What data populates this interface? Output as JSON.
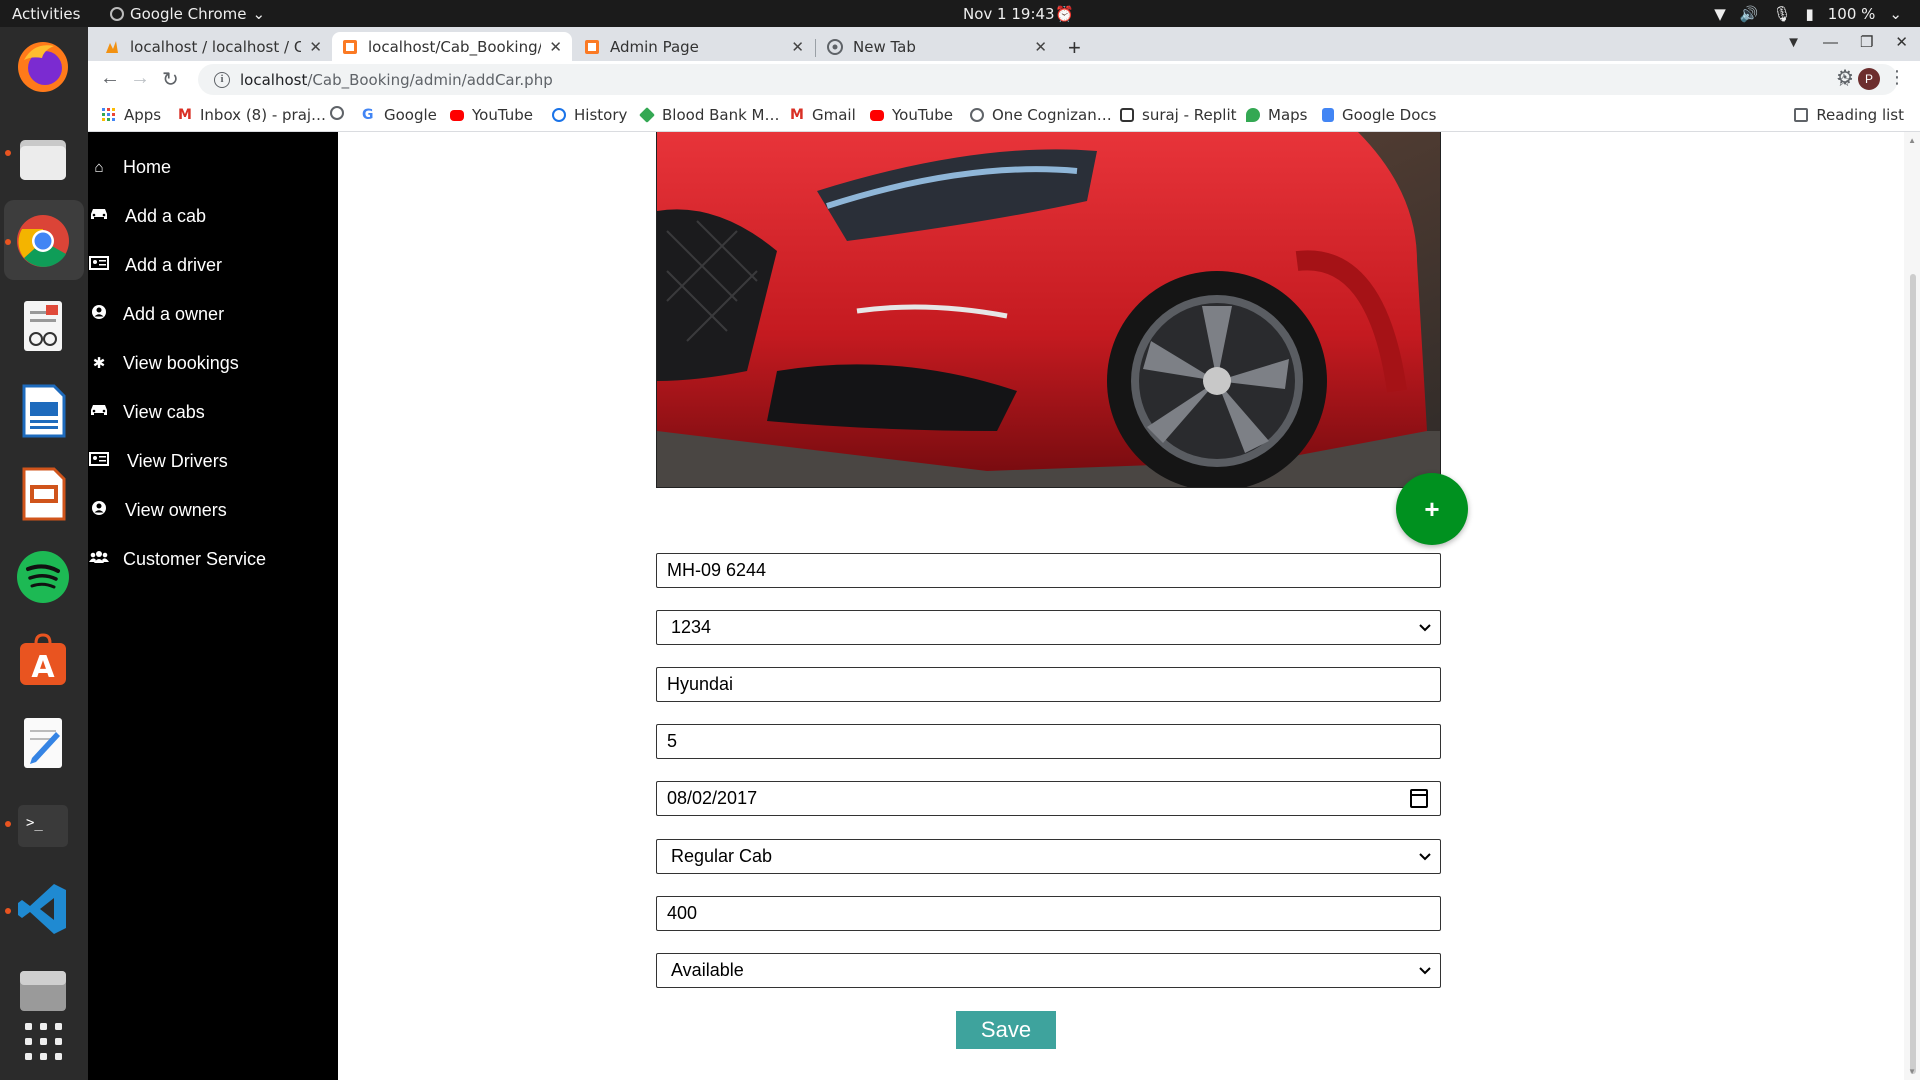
{
  "system_bar": {
    "activities": "Activities",
    "app_name": "Google Chrome",
    "clock": "Nov 1  19:43",
    "battery": "100 %"
  },
  "browser": {
    "tabs": [
      {
        "title": "localhost / localhost / Ca…",
        "active": false
      },
      {
        "title": "localhost/Cab_Booking/a…",
        "active": true
      },
      {
        "title": "Admin Page",
        "active": false
      },
      {
        "title": "New Tab",
        "active": false
      }
    ],
    "url_host": "localhost",
    "url_path": "/Cab_Booking/admin/addCar.php",
    "profile_initial": "P",
    "bookmarks": [
      {
        "label": "Apps",
        "icon": "apps-grid-icon",
        "color": "#4285f4"
      },
      {
        "label": "Inbox (8) - praj…",
        "icon": "gmail-icon",
        "color": "#d93025"
      },
      {
        "label": "",
        "icon": "globe-icon",
        "color": "#5f6368"
      },
      {
        "label": "Google",
        "icon": "google-icon",
        "color": "#4285f4"
      },
      {
        "label": "YouTube",
        "icon": "youtube-icon",
        "color": "#ff0000"
      },
      {
        "label": "History",
        "icon": "history-icon",
        "color": "#1a73e8"
      },
      {
        "label": "Blood Bank M…",
        "icon": "blood-bank-icon",
        "color": "#34a853"
      },
      {
        "label": "Gmail",
        "icon": "gmail-icon",
        "color": "#d93025"
      },
      {
        "label": "YouTube",
        "icon": "youtube-icon",
        "color": "#ff0000"
      },
      {
        "label": "One Cognizan…",
        "icon": "globe-icon",
        "color": "#5f6368"
      },
      {
        "label": "suraj - Replit",
        "icon": "replit-icon",
        "color": "#333333"
      },
      {
        "label": "Maps",
        "icon": "maps-icon",
        "color": "#34a853"
      },
      {
        "label": "Google Docs",
        "icon": "docs-icon",
        "color": "#4285f4"
      }
    ],
    "reading_list": "Reading list"
  },
  "sidebar": {
    "items": [
      {
        "label": "Home",
        "icon": "home-icon",
        "glyph": "⌂"
      },
      {
        "label": "Add a cab",
        "icon": "car-icon",
        "glyph": "🚘"
      },
      {
        "label": "Add a driver",
        "icon": "id-card-icon",
        "glyph": "▤"
      },
      {
        "label": "Add a owner",
        "icon": "user-circle-icon",
        "glyph": "☺"
      },
      {
        "label": "View bookings",
        "icon": "asterisk-icon",
        "glyph": "✱"
      },
      {
        "label": "View cabs",
        "icon": "taxi-icon",
        "glyph": "🚘"
      },
      {
        "label": "View Drivers",
        "icon": "id-card-icon",
        "glyph": "▤"
      },
      {
        "label": "View owners",
        "icon": "user-circle-icon",
        "glyph": "☺"
      },
      {
        "label": "Customer Service",
        "icon": "users-icon",
        "glyph": "⚇"
      }
    ]
  },
  "form": {
    "fab_label": "+",
    "car_number": "MH-09 6244",
    "owner_id": "1234",
    "company": "Hyundai",
    "seats": "5",
    "date": "08/02/2017",
    "cab_type": "Regular Cab",
    "rate": "400",
    "status": "Available",
    "save_label": "Save"
  },
  "colors": {
    "sidebar_bg": "#000000",
    "fab_bg": "#00911f",
    "save_bg": "#3ea39d",
    "car_red": "#d21f23"
  }
}
